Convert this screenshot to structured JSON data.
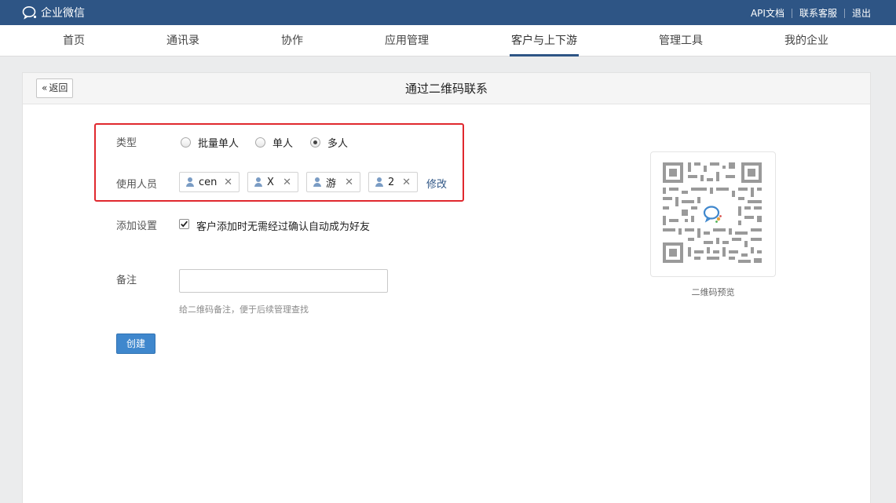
{
  "topbar": {
    "logo_text": "企业微信",
    "links": [
      "API文档",
      "联系客服",
      "退出"
    ]
  },
  "nav": {
    "items": [
      "首页",
      "通讯录",
      "协作",
      "应用管理",
      "客户与上下游",
      "管理工具",
      "我的企业"
    ],
    "active_index": 4
  },
  "card": {
    "back_label": "返回",
    "title": "通过二维码联系"
  },
  "form": {
    "type_label": "类型",
    "type_options": [
      "批量单人",
      "单人",
      "多人"
    ],
    "type_selected": "多人",
    "users_label": "使用人员",
    "users": [
      "cen",
      "X",
      "游",
      "2"
    ],
    "modify_label": "修改",
    "add_settings_label": "添加设置",
    "auto_accept_text": "客户添加时无需经过确认自动成为好友",
    "auto_accept_checked": true,
    "note_label": "备注",
    "note_value": "",
    "note_hint": "给二维码备注，便于后续管理查找",
    "create_label": "创建"
  },
  "qr": {
    "caption": "二维码预览"
  },
  "colors": {
    "topbar": "#2e5585",
    "primary_button": "#3f87cd",
    "highlight": "#e0282e",
    "link": "#2e5585"
  }
}
